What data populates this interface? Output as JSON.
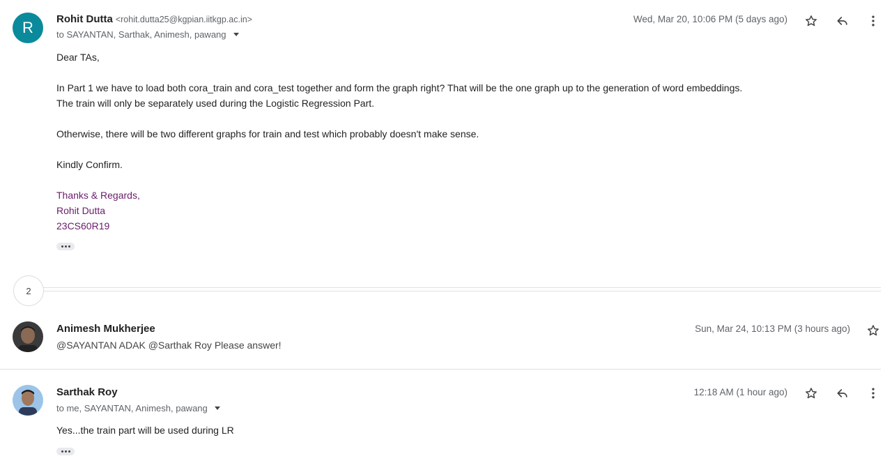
{
  "messages": [
    {
      "avatar_letter": "R",
      "sender": "Rohit Dutta",
      "email": "<rohit.dutta25@kgpian.iitkgp.ac.in>",
      "recipients": "to SAYANTAN, Sarthak, Animesh, pawang",
      "date": "Wed, Mar 20, 10:06 PM (5 days ago)",
      "body": [
        "Dear TAs,",
        "In Part 1 we have to load both cora_train and cora_test together and form the graph right? That will be the one graph up to the generation of word embeddings.",
        "The train will only be separately used during the Logistic Regression Part.",
        "Otherwise, there will be two different graphs for train and test which probably doesn't make sense.",
        "Kindly Confirm."
      ],
      "signature": [
        "Thanks & Regards,",
        "Rohit Dutta",
        "23CS60R19"
      ]
    },
    {
      "sender": "Animesh Mukherjee",
      "date": "Sun, Mar 24, 10:13 PM (3 hours ago)",
      "snippet": "@SAYANTAN ADAK @Sarthak Roy Please answer!"
    },
    {
      "sender": "Sarthak Roy",
      "recipients": "to me, SAYANTAN, Animesh, pawang",
      "date": "12:18 AM (1 hour ago)",
      "body": [
        "Yes...the train part will be used during LR"
      ]
    }
  ],
  "collapsed_count": "2",
  "icons": {
    "star": "star-icon",
    "reply": "reply-icon",
    "more": "more-vert-icon",
    "dropdown": "chevron-down-icon"
  },
  "colors": {
    "avatar_bg": "#0b8a9c",
    "signature": "#6a1b6a"
  }
}
